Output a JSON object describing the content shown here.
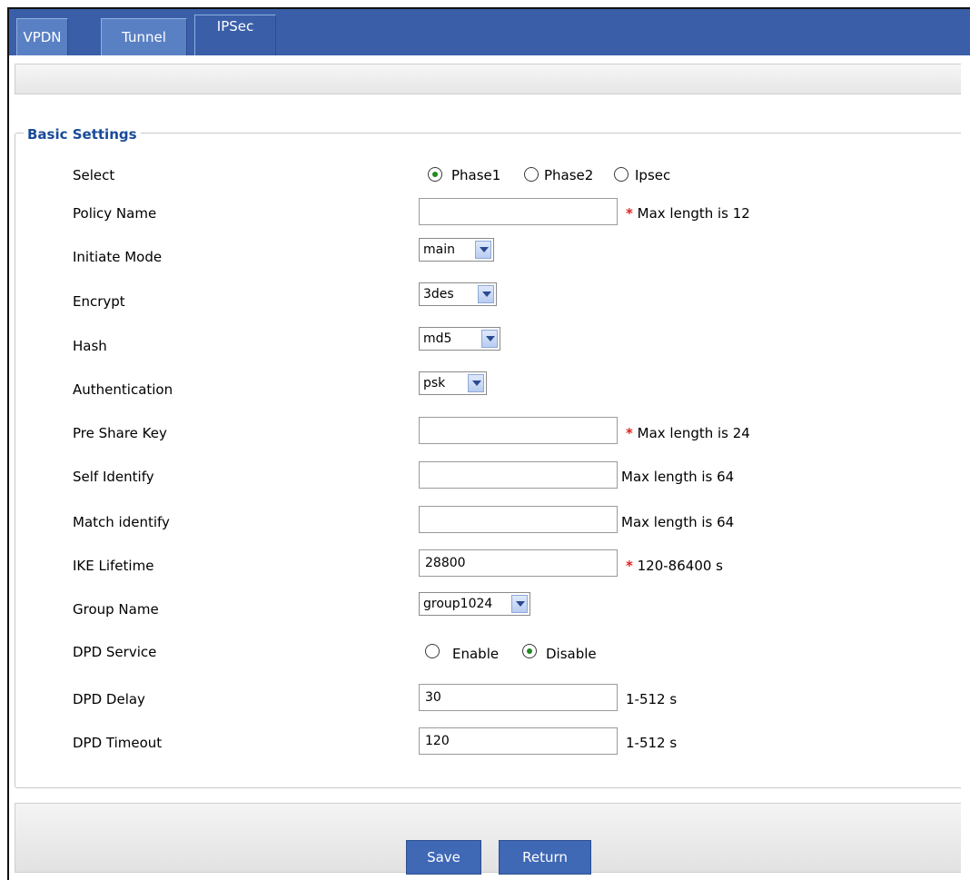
{
  "tabs": [
    {
      "label": "VPDN"
    },
    {
      "label": "Tunnel"
    },
    {
      "label": "IPSec"
    }
  ],
  "section_title": "Basic Settings",
  "fields": {
    "select": {
      "label": "Select",
      "options": [
        "Phase1",
        "Phase2",
        "Ipsec"
      ],
      "selected": "Phase1"
    },
    "policy_name": {
      "label": "Policy Name",
      "value": "",
      "hint": "Max length is 12",
      "required": "*"
    },
    "initiate_mode": {
      "label": "Initiate Mode",
      "value": "main"
    },
    "encrypt": {
      "label": "Encrypt",
      "value": "3des"
    },
    "hash": {
      "label": "Hash",
      "value": "md5"
    },
    "authentication": {
      "label": "Authentication",
      "value": "psk"
    },
    "pre_share_key": {
      "label": "Pre Share Key",
      "value": "",
      "hint": "Max length is 24",
      "required": "*"
    },
    "self_identify": {
      "label": "Self Identify",
      "value": "",
      "hint": "Max length is 64"
    },
    "match_identify": {
      "label": "Match identify",
      "value": "",
      "hint": "Max length is 64"
    },
    "ike_lifetime": {
      "label": "IKE Lifetime",
      "value": "28800",
      "hint": "120-86400 s",
      "required": "*"
    },
    "group_name": {
      "label": "Group Name",
      "value": "group1024"
    },
    "dpd_service": {
      "label": "DPD Service",
      "options": [
        "Enable",
        "Disable"
      ],
      "selected": "Disable"
    },
    "dpd_delay": {
      "label": "DPD Delay",
      "value": "30",
      "hint": "1-512 s"
    },
    "dpd_timeout": {
      "label": "DPD Timeout",
      "value": "120",
      "hint": "1-512 s"
    }
  },
  "buttons": {
    "save": "Save",
    "return": "Return"
  },
  "colors": {
    "tabbar": "#3a5fa8",
    "button": "#3f68b5",
    "section_title": "#1a4a9a",
    "required": "#e02020"
  }
}
